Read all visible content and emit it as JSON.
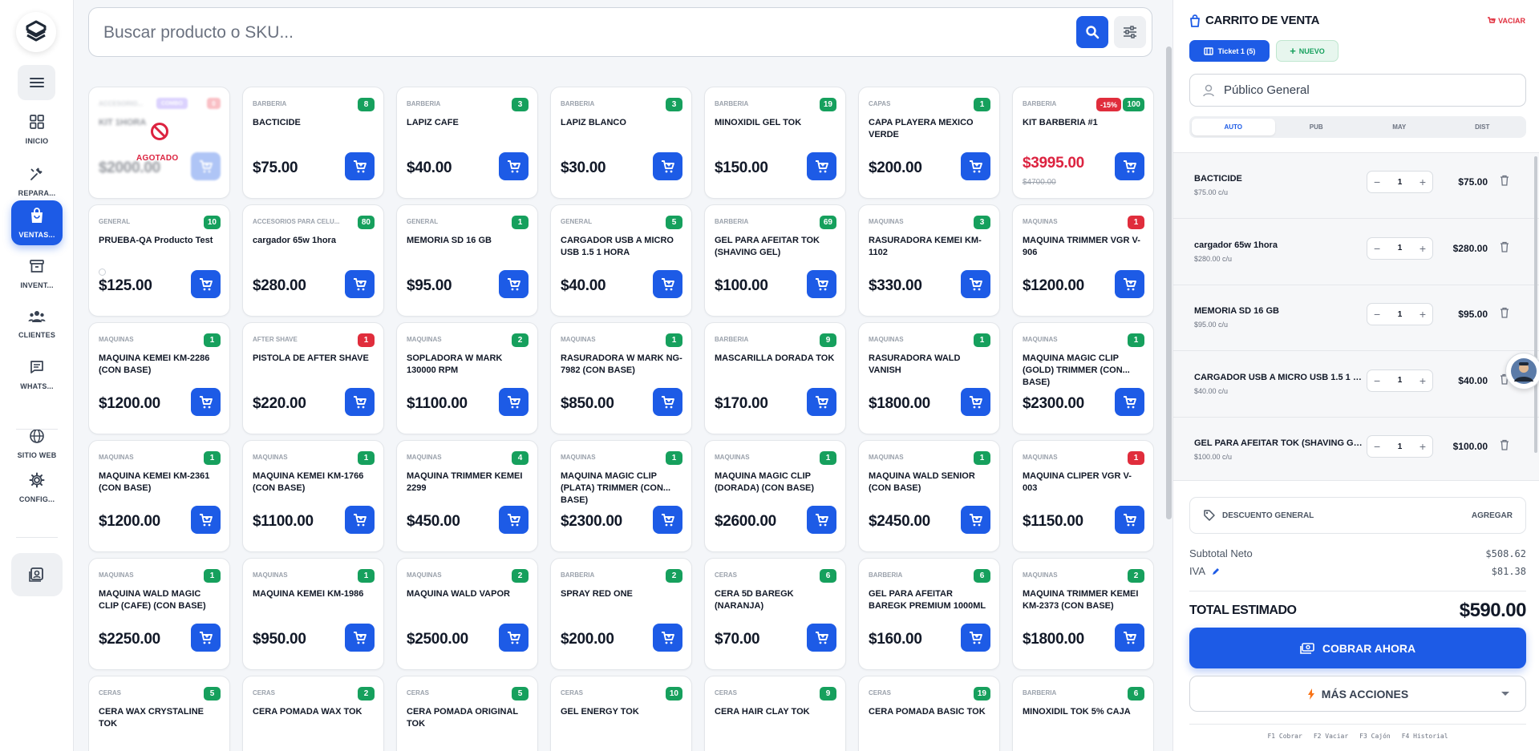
{
  "sidebar": {
    "items": [
      {
        "name": "nav-inicio",
        "icon": "grid-icon",
        "label": "INICIO",
        "top": 0
      },
      {
        "name": "nav-reparaciones",
        "icon": "tools-icon",
        "label": "REPARA..."
      },
      {
        "name": "nav-ventas",
        "icon": "shopping-bag-icon",
        "label": "VENTAS..."
      },
      {
        "name": "nav-inventario",
        "icon": "archive-icon",
        "label": "INVENT..."
      },
      {
        "name": "nav-clientes",
        "icon": "users-icon",
        "label": "CLIENTES"
      },
      {
        "name": "nav-whatsapp",
        "icon": "message-icon",
        "label": "WHATS..."
      },
      {
        "name": "nav-sitio-web",
        "icon": "globe-icon",
        "label": "SITIO WEB"
      },
      {
        "name": "nav-configuracion",
        "icon": "gear-icon",
        "label": "CONFIG..."
      }
    ]
  },
  "search": {
    "placeholder": "Buscar producto o SKU..."
  },
  "products": [
    {
      "category": "ACCESORIO...",
      "name": "KIT 1HORA",
      "price": "$2000.00",
      "stock": "0",
      "combo": "COMBO",
      "out_of_stock": true,
      "out_label": "AGOTADO"
    },
    {
      "category": "BARBERIA",
      "name": "BACTICIDE",
      "price": "$75.00",
      "stock": "8"
    },
    {
      "category": "BARBERIA",
      "name": "LAPIZ CAFE",
      "price": "$40.00",
      "stock": "3"
    },
    {
      "category": "BARBERIA",
      "name": "LAPIZ BLANCO",
      "price": "$30.00",
      "stock": "3"
    },
    {
      "category": "BARBERIA",
      "name": "MINOXIDIL GEL TOK",
      "price": "$150.00",
      "stock": "19"
    },
    {
      "category": "CAPAS",
      "name": "CAPA PLAYERA MEXICO VERDE",
      "price": "$200.00",
      "stock": "1"
    },
    {
      "category": "BARBERIA",
      "name": "KIT BARBERIA #1",
      "price": "$3995.00",
      "old_price": "$4700.00",
      "discount": "-15%",
      "stock": "100",
      "sale": true
    },
    {
      "category": "GENERAL",
      "name": "PRUEBA-QA Producto Test",
      "price": "$125.00",
      "stock": "10",
      "mixed": true,
      "radio": true
    },
    {
      "category": "ACCESORIOS PARA CELU...",
      "name": "cargador 65w 1hora",
      "price": "$280.00",
      "stock": "80",
      "mixed": true
    },
    {
      "category": "GENERAL",
      "name": "MEMORIA SD 16 GB",
      "price": "$95.00",
      "stock": "1"
    },
    {
      "category": "GENERAL",
      "name": "CARGADOR USB A MICRO USB 1.5 1 HORA",
      "price": "$40.00",
      "stock": "5"
    },
    {
      "category": "BARBERIA",
      "name": "GEL PARA AFEITAR TOK (SHAVING GEL)",
      "price": "$100.00",
      "stock": "69"
    },
    {
      "category": "MAQUINAS",
      "name": "RASURADORA KEMEI KM-1102",
      "price": "$330.00",
      "stock": "3"
    },
    {
      "category": "MAQUINAS",
      "name": "MAQUINA TRIMMER VGR V-906",
      "price": "$1200.00",
      "stock": "1",
      "low": true
    },
    {
      "category": "MAQUINAS",
      "name": "MAQUINA KEMEI KM-2286 (CON BASE)",
      "price": "$1200.00",
      "stock": "1"
    },
    {
      "category": "AFTER SHAVE",
      "name": "PISTOLA DE AFTER SHAVE",
      "price": "$220.00",
      "stock": "1",
      "low": true
    },
    {
      "category": "MAQUINAS",
      "name": "SOPLADORA W MARK 130000 RPM",
      "price": "$1100.00",
      "stock": "2"
    },
    {
      "category": "MAQUINAS",
      "name": "RASURADORA W MARK NG-7982 (CON BASE)",
      "price": "$850.00",
      "stock": "1"
    },
    {
      "category": "BARBERIA",
      "name": "MASCARILLA DORADA TOK",
      "price": "$170.00",
      "stock": "9"
    },
    {
      "category": "MAQUINAS",
      "name": "RASURADORA WALD VANISH",
      "price": "$1800.00",
      "stock": "1"
    },
    {
      "category": "MAQUINAS",
      "name": "MAQUINA MAGIC CLIP (GOLD) TRIMMER (CON... BASE)",
      "price": "$2300.00",
      "stock": "1"
    },
    {
      "category": "MAQUINAS",
      "name": "MAQUINA KEMEI KM-2361 (CON BASE)",
      "price": "$1200.00",
      "stock": "1"
    },
    {
      "category": "MAQUINAS",
      "name": "MAQUINA KEMEI KM-1766 (CON BASE)",
      "price": "$1100.00",
      "stock": "1"
    },
    {
      "category": "MAQUINAS",
      "name": "MAQUINA TRIMMER KEMEI 2299",
      "price": "$450.00",
      "stock": "4"
    },
    {
      "category": "MAQUINAS",
      "name": "MAQUINA MAGIC CLIP (PLATA) TRIMMER (CON... BASE)",
      "price": "$2300.00",
      "stock": "1"
    },
    {
      "category": "MAQUINAS",
      "name": "MAQUINA MAGIC CLIP (DORADA) (CON BASE)",
      "price": "$2600.00",
      "stock": "1"
    },
    {
      "category": "MAQUINAS",
      "name": "MAQUINA WALD SENIOR (CON BASE)",
      "price": "$2450.00",
      "stock": "1"
    },
    {
      "category": "MAQUINAS",
      "name": "MAQUINA CLIPER VGR V-003",
      "price": "$1150.00",
      "stock": "1",
      "low": true
    },
    {
      "category": "MAQUINAS",
      "name": "MAQUINA WALD MAGIC CLIP (CAFE) (CON BASE)",
      "price": "$2250.00",
      "stock": "1"
    },
    {
      "category": "MAQUINAS",
      "name": "MAQUINA KEMEI KM-1986",
      "price": "$950.00",
      "stock": "1"
    },
    {
      "category": "MAQUINAS",
      "name": "MAQUINA WALD VAPOR",
      "price": "$2500.00",
      "stock": "2"
    },
    {
      "category": "BARBERIA",
      "name": "SPRAY RED ONE",
      "price": "$200.00",
      "stock": "2"
    },
    {
      "category": "CERAS",
      "name": "CERA 5D BAREGK (NARANJA)",
      "price": "$70.00",
      "stock": "6"
    },
    {
      "category": "BARBERIA",
      "name": "GEL PARA AFEITAR BAREGK PREMIUM 1000ML",
      "price": "$160.00",
      "stock": "6"
    },
    {
      "category": "MAQUINAS",
      "name": "MAQUINA TRIMMER KEMEI KM-2373 (CON BASE)",
      "price": "$1800.00",
      "stock": "2"
    },
    {
      "category": "CERAS",
      "name": "CERA WAX CRYSTALINE TOK",
      "price": "",
      "stock": "5"
    },
    {
      "category": "CERAS",
      "name": "CERA POMADA WAX TOK",
      "price": "",
      "stock": "2"
    },
    {
      "category": "CERAS",
      "name": "CERA POMADA ORIGINAL TOK",
      "price": "",
      "stock": "5"
    },
    {
      "category": "CERAS",
      "name": "GEL ENERGY TOK",
      "price": "",
      "stock": "10"
    },
    {
      "category": "CERAS",
      "name": "CERA HAIR CLAY TOK",
      "price": "",
      "stock": "9"
    },
    {
      "category": "CERAS",
      "name": "CERA POMADA BASIC TOK",
      "price": "",
      "stock": "19"
    },
    {
      "category": "BARBERIA",
      "name": "MINOXIDIL TOK 5% CAJA",
      "price": "",
      "stock": "6"
    }
  ],
  "cart": {
    "title": "CARRITO DE VENTA",
    "clear_label": "VACIAR",
    "ticket_label": "Ticket 1 (5)",
    "new_label": "NUEVO",
    "customer": "Público General",
    "price_tabs": [
      "AUTO",
      "PUB",
      "MAY",
      "DIST"
    ],
    "items": [
      {
        "name": "BACTICIDE",
        "unit": "$75.00 c/u",
        "qty": "1",
        "total": "$75.00"
      },
      {
        "name": "cargador 65w 1hora",
        "unit": "$280.00 c/u",
        "qty": "1",
        "total": "$280.00"
      },
      {
        "name": "MEMORIA SD 16 GB",
        "unit": "$95.00 c/u",
        "qty": "1",
        "total": "$95.00"
      },
      {
        "name": "CARGADOR USB A MICRO USB 1.5 1 HORA",
        "unit": "$40.00 c/u",
        "qty": "1",
        "total": "$40.00"
      },
      {
        "name": "GEL PARA AFEITAR TOK (SHAVING GEL)",
        "unit": "$100.00 c/u",
        "qty": "1",
        "total": "$100.00"
      }
    ],
    "discount_label": "DESCUENTO GENERAL",
    "discount_action": "AGREGAR",
    "subtotal_label": "Subtotal Neto",
    "subtotal_value": "$508.62",
    "iva_label": "IVA",
    "iva_value": "$81.38",
    "total_label": "TOTAL ESTIMADO",
    "total_value": "$590.00",
    "charge_label": "COBRAR AHORA",
    "more_label": "MÁS ACCIONES",
    "shortcuts": [
      "F1 Cobrar",
      "F2 Vaciar",
      "F3 Cajón",
      "F4 Historial"
    ]
  },
  "colors": {
    "accent": "#1d5be6",
    "stock_ok": "#16a05d",
    "stock_low": "#e02d3c",
    "sale": "#dc2340"
  }
}
